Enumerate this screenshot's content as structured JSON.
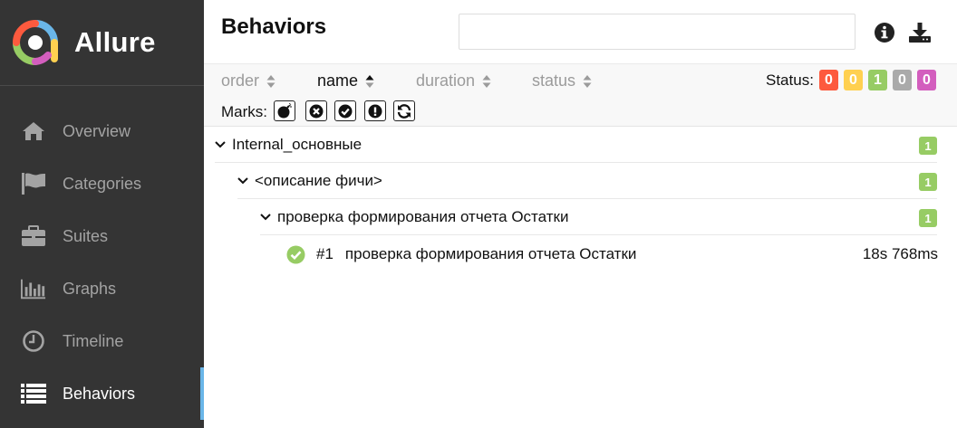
{
  "sidebar": {
    "brand": "Allure",
    "items": [
      {
        "label": "Overview",
        "icon": "home-icon"
      },
      {
        "label": "Categories",
        "icon": "flag-icon"
      },
      {
        "label": "Suites",
        "icon": "briefcase-icon"
      },
      {
        "label": "Graphs",
        "icon": "bar-chart-icon"
      },
      {
        "label": "Timeline",
        "icon": "clock-icon"
      },
      {
        "label": "Behaviors",
        "icon": "list-icon",
        "active": true
      }
    ]
  },
  "header": {
    "title": "Behaviors",
    "search_value": "",
    "icons": [
      "info-icon",
      "download-icon"
    ]
  },
  "toolbar": {
    "sort": [
      {
        "label": "order"
      },
      {
        "label": "name",
        "active": true
      },
      {
        "label": "duration"
      },
      {
        "label": "status"
      }
    ],
    "status_label": "Status:",
    "status_counts": [
      {
        "value": "0",
        "status": "failed",
        "color": "#fd5a3e"
      },
      {
        "value": "0",
        "status": "broken",
        "color": "#ffd050"
      },
      {
        "value": "1",
        "status": "passed",
        "color": "#97cc64"
      },
      {
        "value": "0",
        "status": "skipped",
        "color": "#aaaaaa"
      },
      {
        "value": "0",
        "status": "unknown",
        "color": "#d35ebe"
      }
    ],
    "marks_label": "Marks:",
    "marks": [
      "bomb-icon",
      "times-circle-icon",
      "check-circle-icon",
      "exclamation-circle-icon",
      "refresh-icon"
    ]
  },
  "tree": {
    "groups": [
      {
        "name": "Internal_основные",
        "count": "1"
      },
      {
        "name": "<описание фичи>",
        "count": "1"
      },
      {
        "name": "проверка формирования отчета Остатки",
        "count": "1"
      }
    ],
    "test": {
      "num": "#1",
      "name": "проверка формирования отчета Остатки",
      "duration": "18s 768ms",
      "status": "passed",
      "icon": "check-circle-icon",
      "color": "#97cc64"
    }
  }
}
